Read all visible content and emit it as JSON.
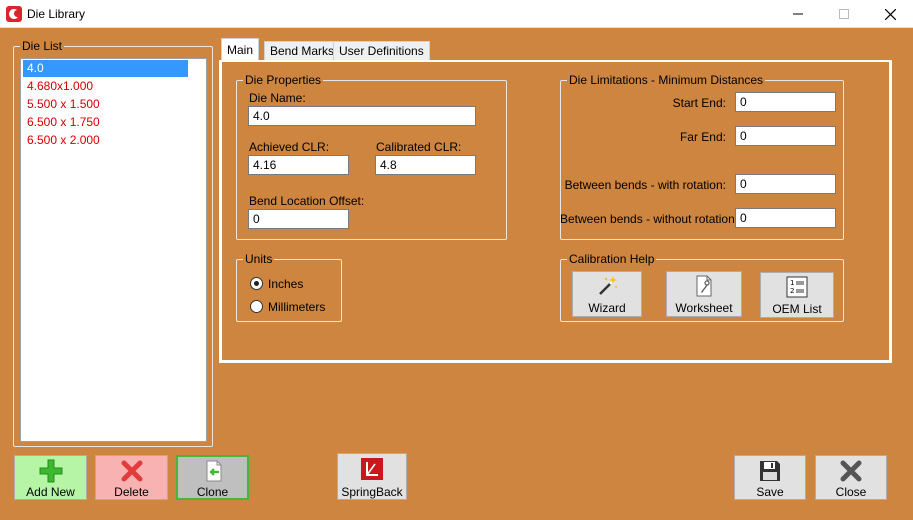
{
  "window": {
    "title": "Die Library"
  },
  "die_list": {
    "label": "Die List",
    "items": [
      {
        "label": "4.0",
        "selected": true
      },
      {
        "label": "4.680x1.000",
        "selected": false
      },
      {
        "label": "5.500 x 1.500",
        "selected": false
      },
      {
        "label": "6.500 x 1.750",
        "selected": false
      },
      {
        "label": "6.500 x 2.000",
        "selected": false
      }
    ]
  },
  "tabs": [
    "Main",
    "Bend Marks",
    "User Definitions"
  ],
  "die_properties": {
    "label": "Die Properties",
    "die_name_label": "Die Name:",
    "die_name_value": "4.0",
    "achieved_clr_label": "Achieved CLR:",
    "achieved_clr_value": "4.16",
    "calibrated_clr_label": "Calibrated CLR:",
    "calibrated_clr_value": "4.8",
    "bend_offset_label": "Bend Location Offset:",
    "bend_offset_value": "0"
  },
  "units": {
    "label": "Units",
    "inches_label": "Inches",
    "mm_label": "Millimeters",
    "selected": "inches"
  },
  "limitations": {
    "label": "Die Limitations - Minimum Distances",
    "start_end_label": "Start End:",
    "start_end_value": "0",
    "far_end_label": "Far End:",
    "far_end_value": "0",
    "with_rotation_label": "Between bends - with rotation:",
    "with_rotation_value": "0",
    "without_rotation_label": "Between bends - without rotation:",
    "without_rotation_value": "0"
  },
  "calibration": {
    "label": "Calibration Help",
    "wizard_label": "Wizard",
    "worksheet_label": "Worksheet",
    "oem_label": "OEM List"
  },
  "bottom": {
    "add_new_label": "Add New",
    "delete_label": "Delete",
    "clone_label": "Clone",
    "springback_label": "SpringBack",
    "save_label": "Save",
    "close_label": "Close"
  },
  "colors": {
    "background": "#cd853f",
    "add_new_bg": "#b6f5a6",
    "delete_bg": "#f8b2b2",
    "list_item_text": "#d40000",
    "selection": "#3399ff"
  }
}
